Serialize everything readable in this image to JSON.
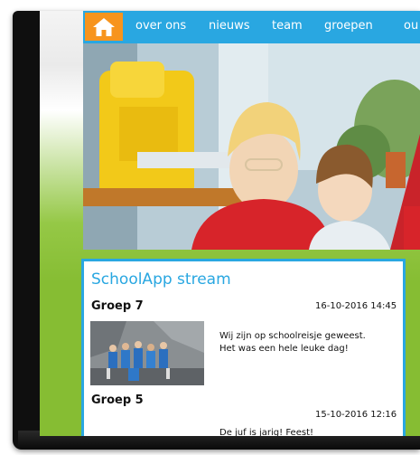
{
  "nav": {
    "items": [
      {
        "label": "over ons"
      },
      {
        "label": "nieuws"
      },
      {
        "label": "team"
      },
      {
        "label": "groepen"
      },
      {
        "label": "ou"
      }
    ]
  },
  "stream": {
    "title": "SchoolApp stream",
    "posts": [
      {
        "group": "Groep 7",
        "date": "16-10-2016 14:45",
        "message": "Wij zijn op schoolreisje geweest.\nHet was een hele leuke dag!"
      },
      {
        "group": "Groep 5",
        "date": "15-10-2016 12:16",
        "message": "De juf is jarig! Feest!"
      }
    ]
  },
  "colors": {
    "nav": "#29a7e1",
    "home": "#f7941d",
    "background": "#86bd33",
    "card_border": "#29a7e1"
  }
}
